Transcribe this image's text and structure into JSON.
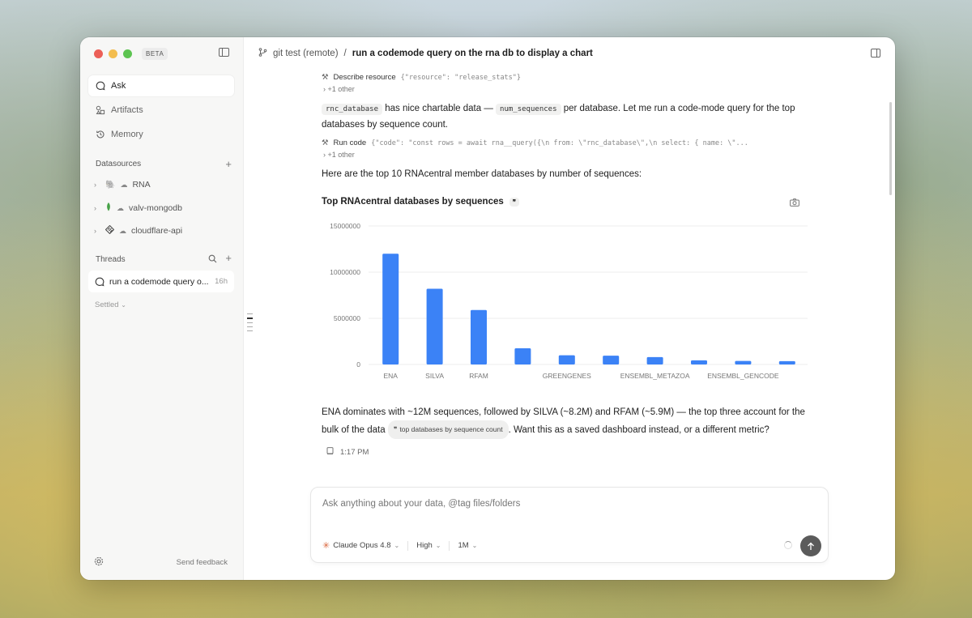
{
  "sidebar": {
    "beta_label": "BETA",
    "nav": [
      {
        "label": "Ask",
        "icon": "chat-bubble-icon"
      },
      {
        "label": "Artifacts",
        "icon": "shapes-icon"
      },
      {
        "label": "Memory",
        "icon": "history-icon"
      }
    ],
    "datasources_label": "Datasources",
    "datasources": [
      {
        "label": "RNA",
        "icon": "postgres-icon"
      },
      {
        "label": "valv-mongodb",
        "icon": "mongodb-leaf-icon"
      },
      {
        "label": "cloudflare-api",
        "icon": "api-icon"
      }
    ],
    "threads_label": "Threads",
    "thread": {
      "label": "run a codemode query o...",
      "time": "16h"
    },
    "settled_label": "Settled",
    "feedback_label": "Send feedback"
  },
  "topbar": {
    "repo": "git test (remote)",
    "separator": "/",
    "title": "run a codemode query on the rna db to display a chart"
  },
  "conversation": {
    "tool1": {
      "name": "Describe resource",
      "args": "{\"resource\": \"release_stats\"}",
      "more": "+1 other"
    },
    "msg1": {
      "code1": "rnc_database",
      "text1": "has nice chartable data —",
      "code2": "num_sequences",
      "text2": "per database. Let me run a code-mode query for the top databases by sequence count."
    },
    "tool2": {
      "name": "Run code",
      "args": "{\"code\": \"const rows = await rna__query({\\n from: \\\"rnc_database\\\",\\n select: { name: \\\"...",
      "more": "+1 other"
    },
    "msg2": "Here are the top 10 RNAcentral member databases by number of sequences:",
    "msg3": {
      "text1": "ENA dominates with ~12M sequences, followed by SILVA (~8.2M) and RFAM (~5.9M) — the top three account for the bulk of the data",
      "ref": "top databases by sequence count",
      "text2": ". Want this as a saved dashboard instead, or a different metric?"
    },
    "timestamp": "1:17 PM"
  },
  "chart_card": {
    "badge": "❞"
  },
  "chart_data": {
    "type": "bar",
    "title": "Top RNAcentral databases by sequences",
    "categories": [
      "ENA",
      "SILVA",
      "RFAM",
      "",
      "GREENGENES",
      "",
      "ENSEMBL_METAZOA",
      "",
      "ENSEMBL_GENCODE",
      ""
    ],
    "x_tick_labels_shown": [
      "ENA",
      "RFAM",
      "GREENGENES",
      "ENSEMBL_METAZOA",
      "ENSEMBL_GENCODE"
    ],
    "values": [
      12000000,
      8200000,
      5900000,
      1750000,
      1000000,
      950000,
      800000,
      450000,
      380000,
      360000
    ],
    "y_ticks": [
      0,
      5000000,
      10000000,
      15000000
    ],
    "ylim": [
      0,
      15000000
    ],
    "grid": true,
    "bar_color": "#3b82f6"
  },
  "composer": {
    "placeholder": "Ask anything about your data, @tag files/folders",
    "model": "Claude Opus 4.8",
    "effort": "High",
    "context": "1M"
  }
}
